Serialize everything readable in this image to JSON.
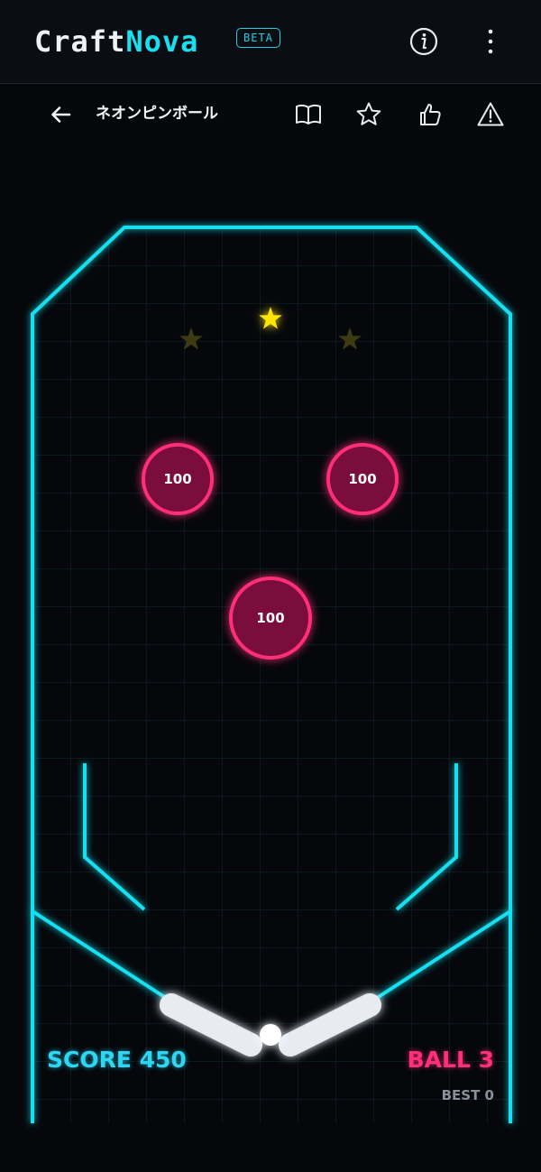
{
  "brand": {
    "name_part1": "Craft",
    "name_part2": "Nova",
    "badge": "BETA"
  },
  "topbar": {
    "icons": [
      "info-icon",
      "more-vertical-icon"
    ]
  },
  "nav": {
    "title": "ネオンピンボール",
    "icons": [
      "back-arrow-icon",
      "book-icon",
      "star-icon",
      "thumbs-up-icon",
      "warning-icon"
    ]
  },
  "game": {
    "bumpers": [
      {
        "label": "100"
      },
      {
        "label": "100"
      },
      {
        "label": "100"
      }
    ],
    "stars": [
      {
        "state": "off"
      },
      {
        "state": "on"
      },
      {
        "state": "off"
      }
    ],
    "hud": {
      "score": "SCORE 450",
      "ball": "BALL 3",
      "best": "BEST 0"
    }
  },
  "colors": {
    "neon_cyan": "#19e0f0",
    "neon_pink": "#ff2f78",
    "star_on": "#ffe600",
    "star_off": "#3d3a14",
    "background": "#05070b"
  }
}
